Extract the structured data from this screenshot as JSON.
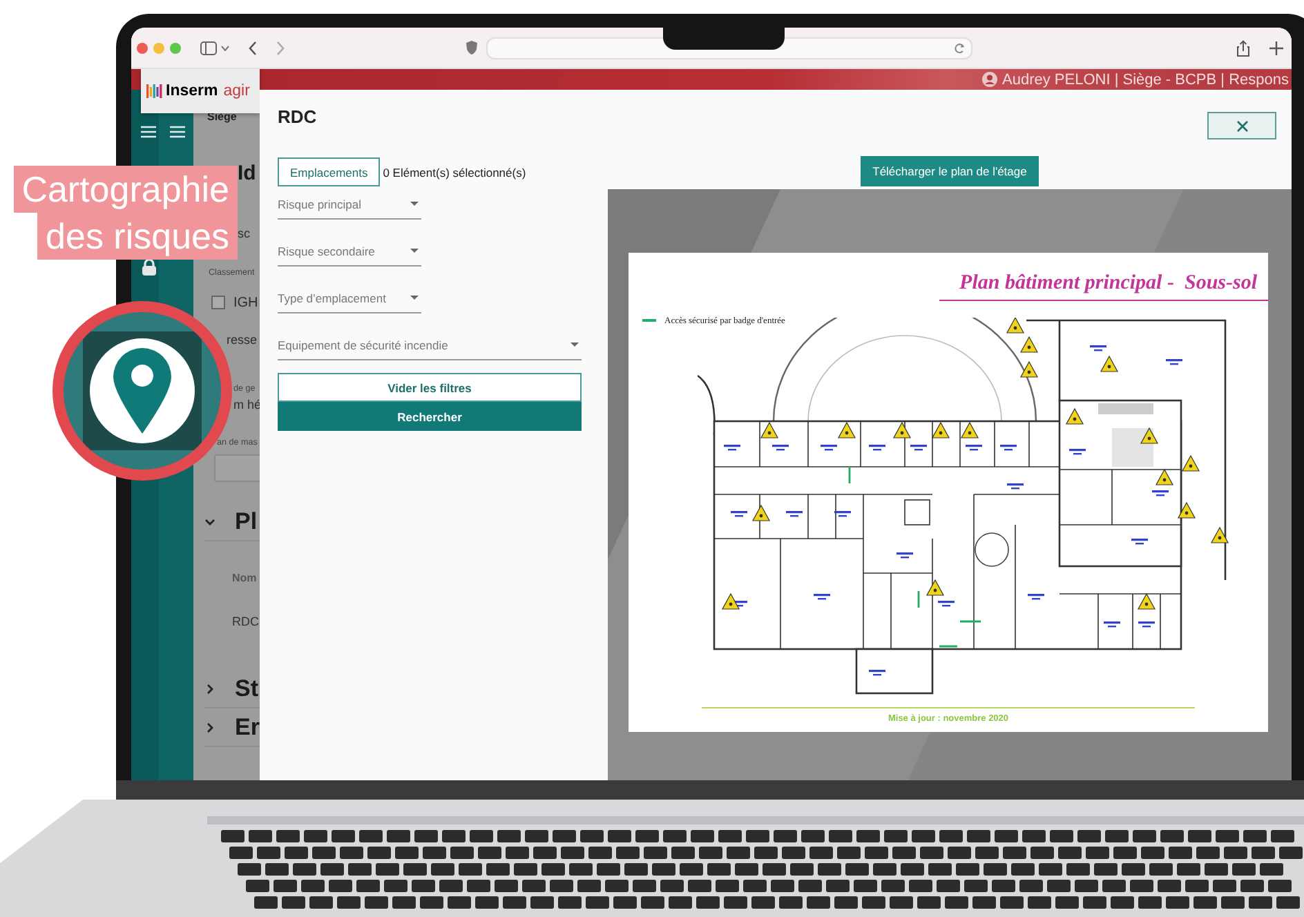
{
  "promo": {
    "label_lines": [
      "Cartographie",
      "des risques"
    ]
  },
  "app": {
    "logo": {
      "name": "Inserm",
      "suffix": "agir"
    },
    "user": "Audrey PELONI | Siège - BCPB | Respons",
    "breadcrumb": "Siège"
  },
  "background_page": {
    "items": [
      {
        "kind": "heading",
        "text": "Id"
      },
      {
        "kind": "value",
        "text": "sc"
      },
      {
        "kind": "label",
        "text": "Classement"
      },
      {
        "kind": "checkbox",
        "text": "IGH",
        "checked": false
      },
      {
        "kind": "value",
        "text": "resse"
      },
      {
        "kind": "label",
        "text": "de ge"
      },
      {
        "kind": "value",
        "text": "m hé"
      },
      {
        "kind": "label",
        "text": "an de mas"
      },
      {
        "kind": "input"
      },
      {
        "kind": "section",
        "text": "Pl",
        "expanded": true
      },
      {
        "kind": "column",
        "text": "Nom"
      },
      {
        "kind": "cell",
        "text": "RDC"
      },
      {
        "kind": "section",
        "text": "St",
        "expanded": false
      },
      {
        "kind": "section",
        "text": "Er",
        "expanded": false
      }
    ]
  },
  "modal": {
    "title": "RDC",
    "locations_button": "Emplacements",
    "selection_count": "0 Elément(s) sélectionné(s)",
    "filters": [
      {
        "placeholder": "Risque principal",
        "kind": "compact"
      },
      {
        "placeholder": "Risque secondaire",
        "kind": "compact"
      },
      {
        "placeholder": "Type d’emplacement",
        "kind": "compact"
      },
      {
        "placeholder": "Equipement de sécurité incendie",
        "kind": "full"
      }
    ],
    "clear_button": "Vider les filtres",
    "search_button": "Rechercher",
    "download_button": "Télécharger le plan de l'étage",
    "plan": {
      "title": "Plan bâtiment principal -  Sous-sol",
      "legend": "Accès sécurisé par badge d'entrée",
      "updated": "Mise à jour : novembre 2020"
    }
  }
}
